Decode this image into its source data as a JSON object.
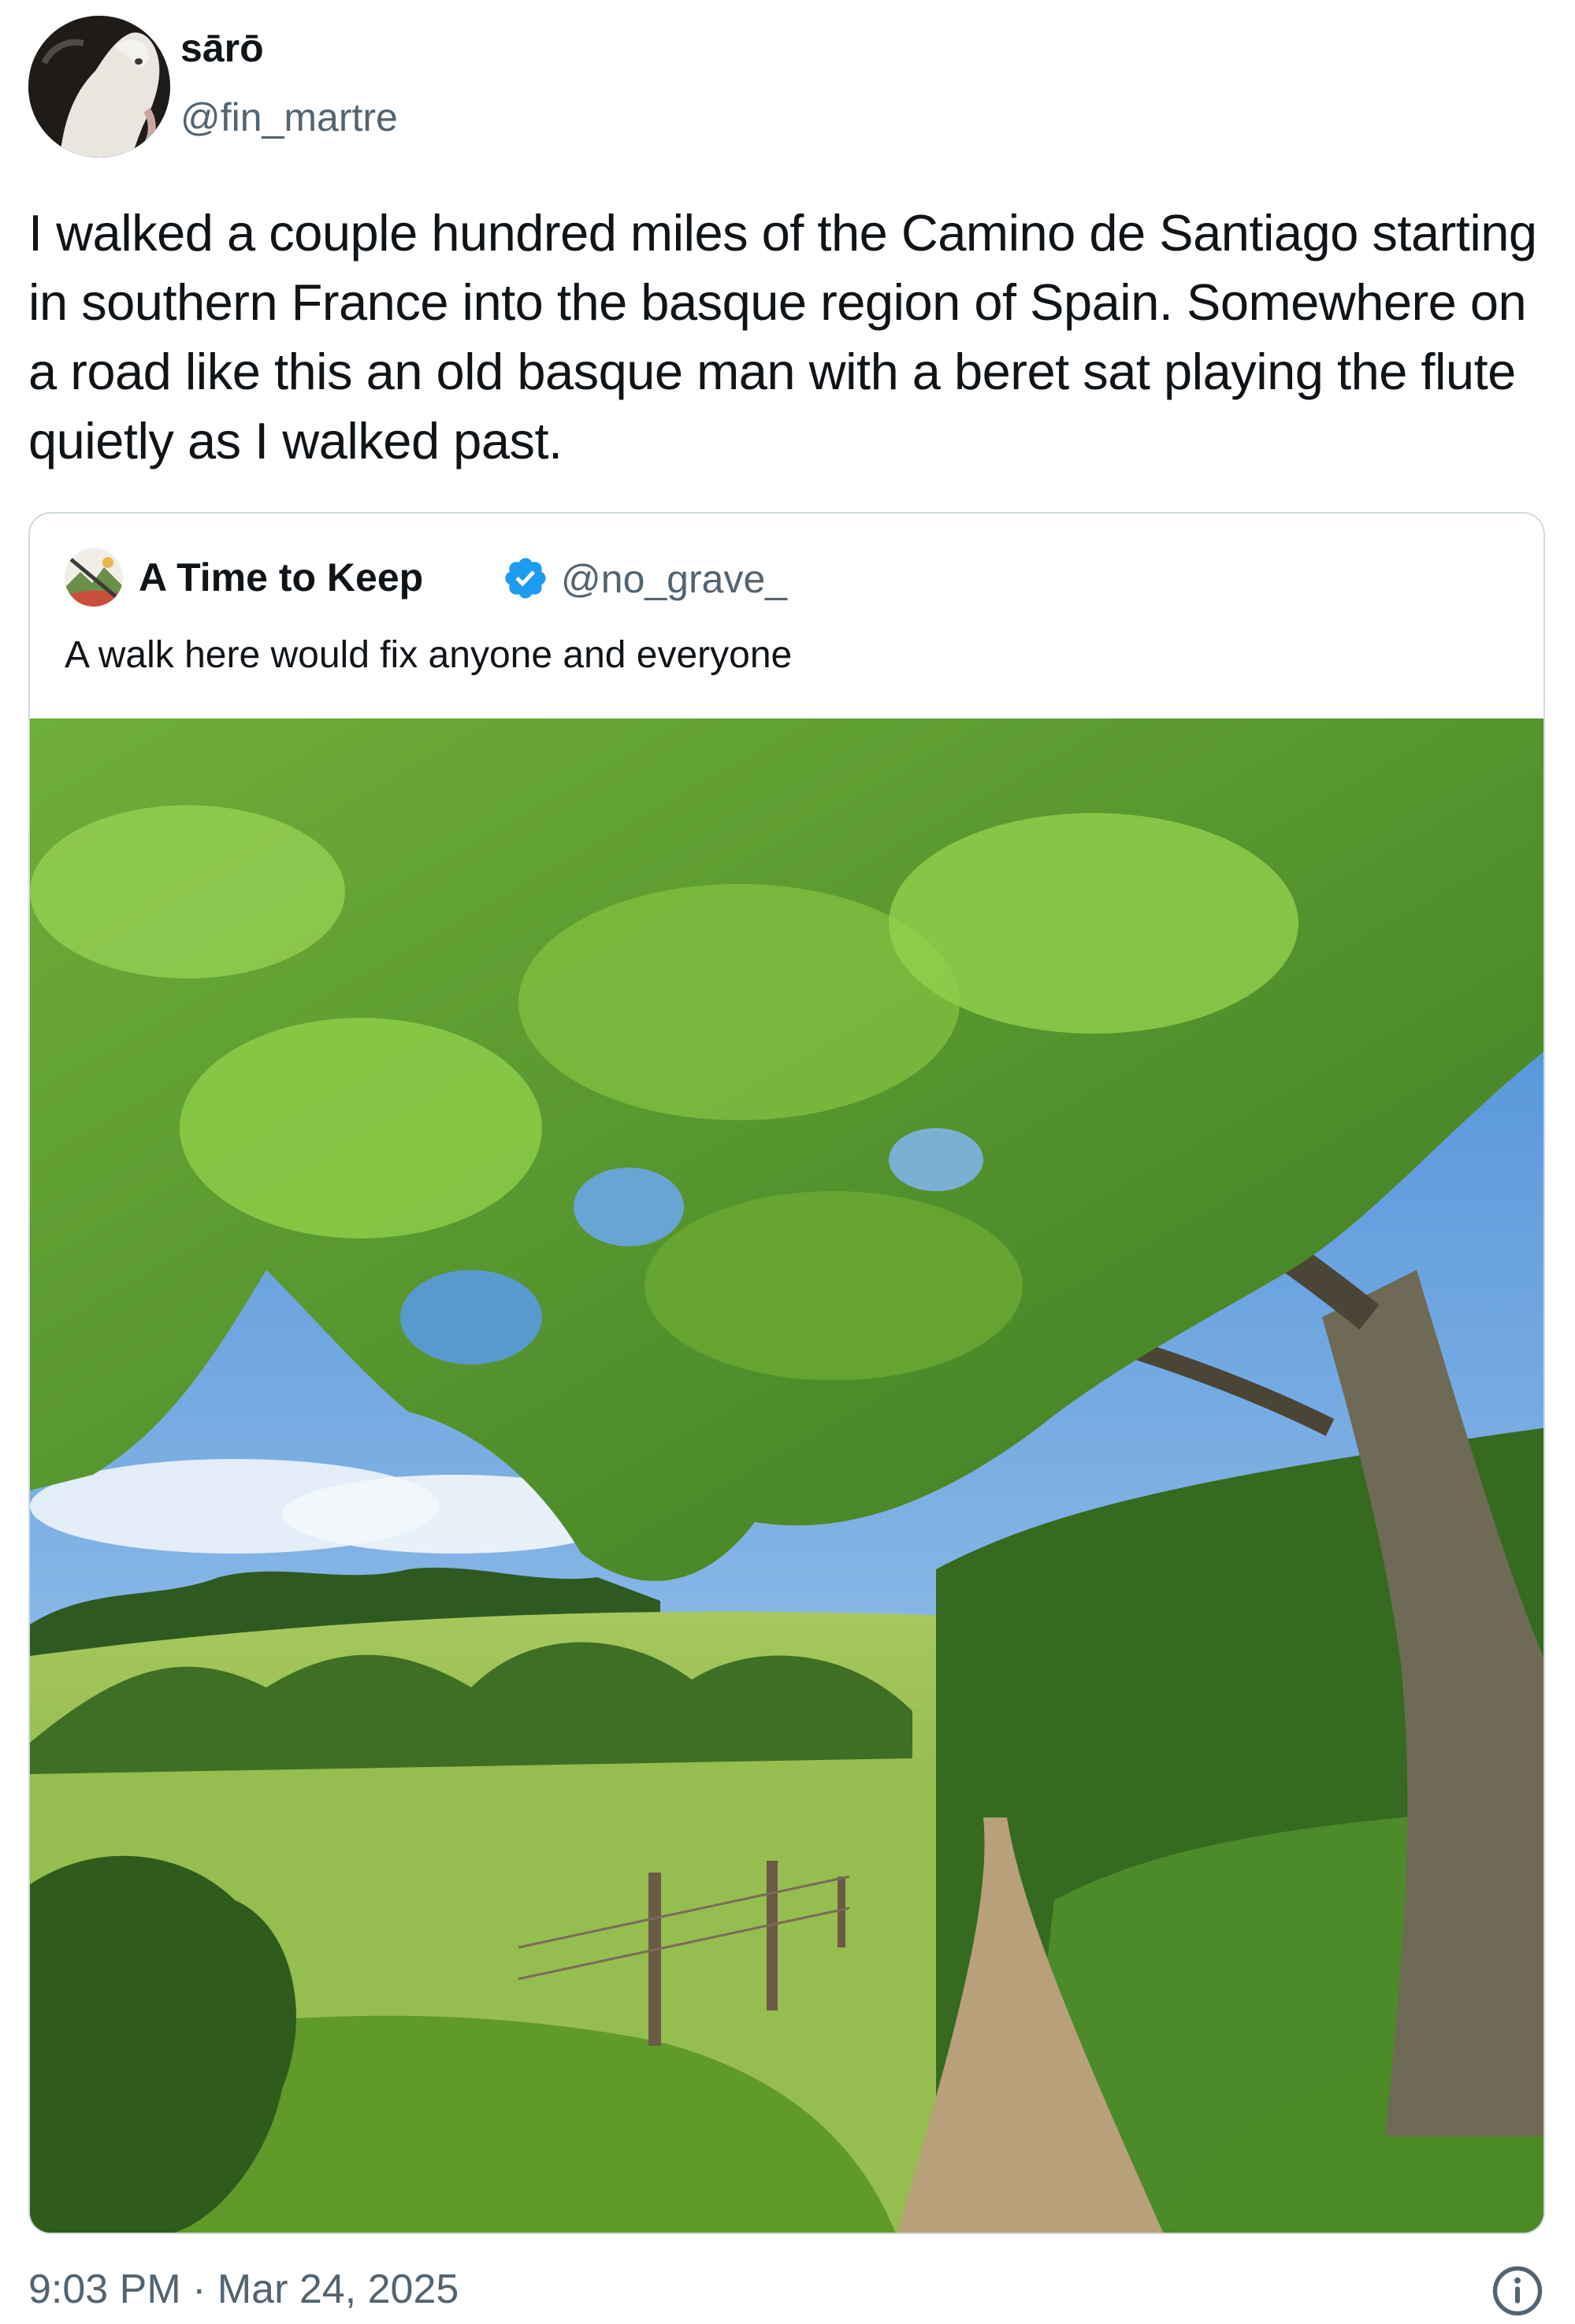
{
  "tweet": {
    "author": {
      "name": "sārō",
      "handle": "@fin_martre",
      "avatar_icon": "white-horse-avatar"
    },
    "text": "I walked a couple hundred miles of the Camino de Santiago starting in southern France into the basque region of Spain. Somewhere on a road like this an old basque man with a beret sat playing the flute quietly as I walked past.",
    "timestamp": "9:03 PM · Mar 24, 2025",
    "info_icon": "info-icon"
  },
  "quote": {
    "author": {
      "name": "A Time to Keep",
      "handle": "@no_grave_",
      "verified": true,
      "avatar_icon": "landscape-avatar"
    },
    "text": "A walk here would fix anyone and everyone",
    "photo_icon": "countryside-path-photo"
  },
  "colors": {
    "text": "#0f1419",
    "secondary_text": "#536471",
    "border": "#cfd9de",
    "verified_blue": "#1d9bf0"
  }
}
